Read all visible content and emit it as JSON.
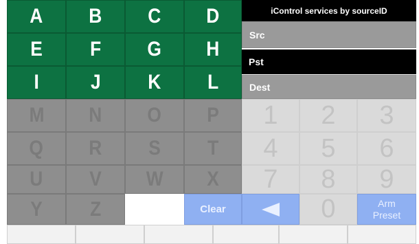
{
  "header": {
    "title": "iControl services by sourceID"
  },
  "fields": [
    {
      "label": "Src",
      "selected": false
    },
    {
      "label": "Pst",
      "selected": true
    },
    {
      "label": "Dest",
      "selected": false
    }
  ],
  "letters": {
    "active": [
      "A",
      "B",
      "C",
      "D",
      "E",
      "F",
      "G",
      "H",
      "I",
      "J",
      "K",
      "L"
    ],
    "inactive": [
      "M",
      "N",
      "O",
      "P",
      "Q",
      "R",
      "S",
      "T",
      "U",
      "V",
      "W",
      "X",
      "Y",
      "Z"
    ]
  },
  "numpad": [
    "1",
    "2",
    "3",
    "4",
    "5",
    "6",
    "7",
    "8",
    "9",
    "0"
  ],
  "actions": {
    "clear": "Clear",
    "back_icon": "left-arrow-icon",
    "arm_preset": "Arm\nPreset"
  },
  "colors": {
    "active_key": "#0d7242",
    "inactive_key": "#8e8e8e",
    "numpad_key": "#dadada",
    "action_key": "#8fb0f2",
    "selected_field": "#000000",
    "field": "#9a9a9a"
  }
}
